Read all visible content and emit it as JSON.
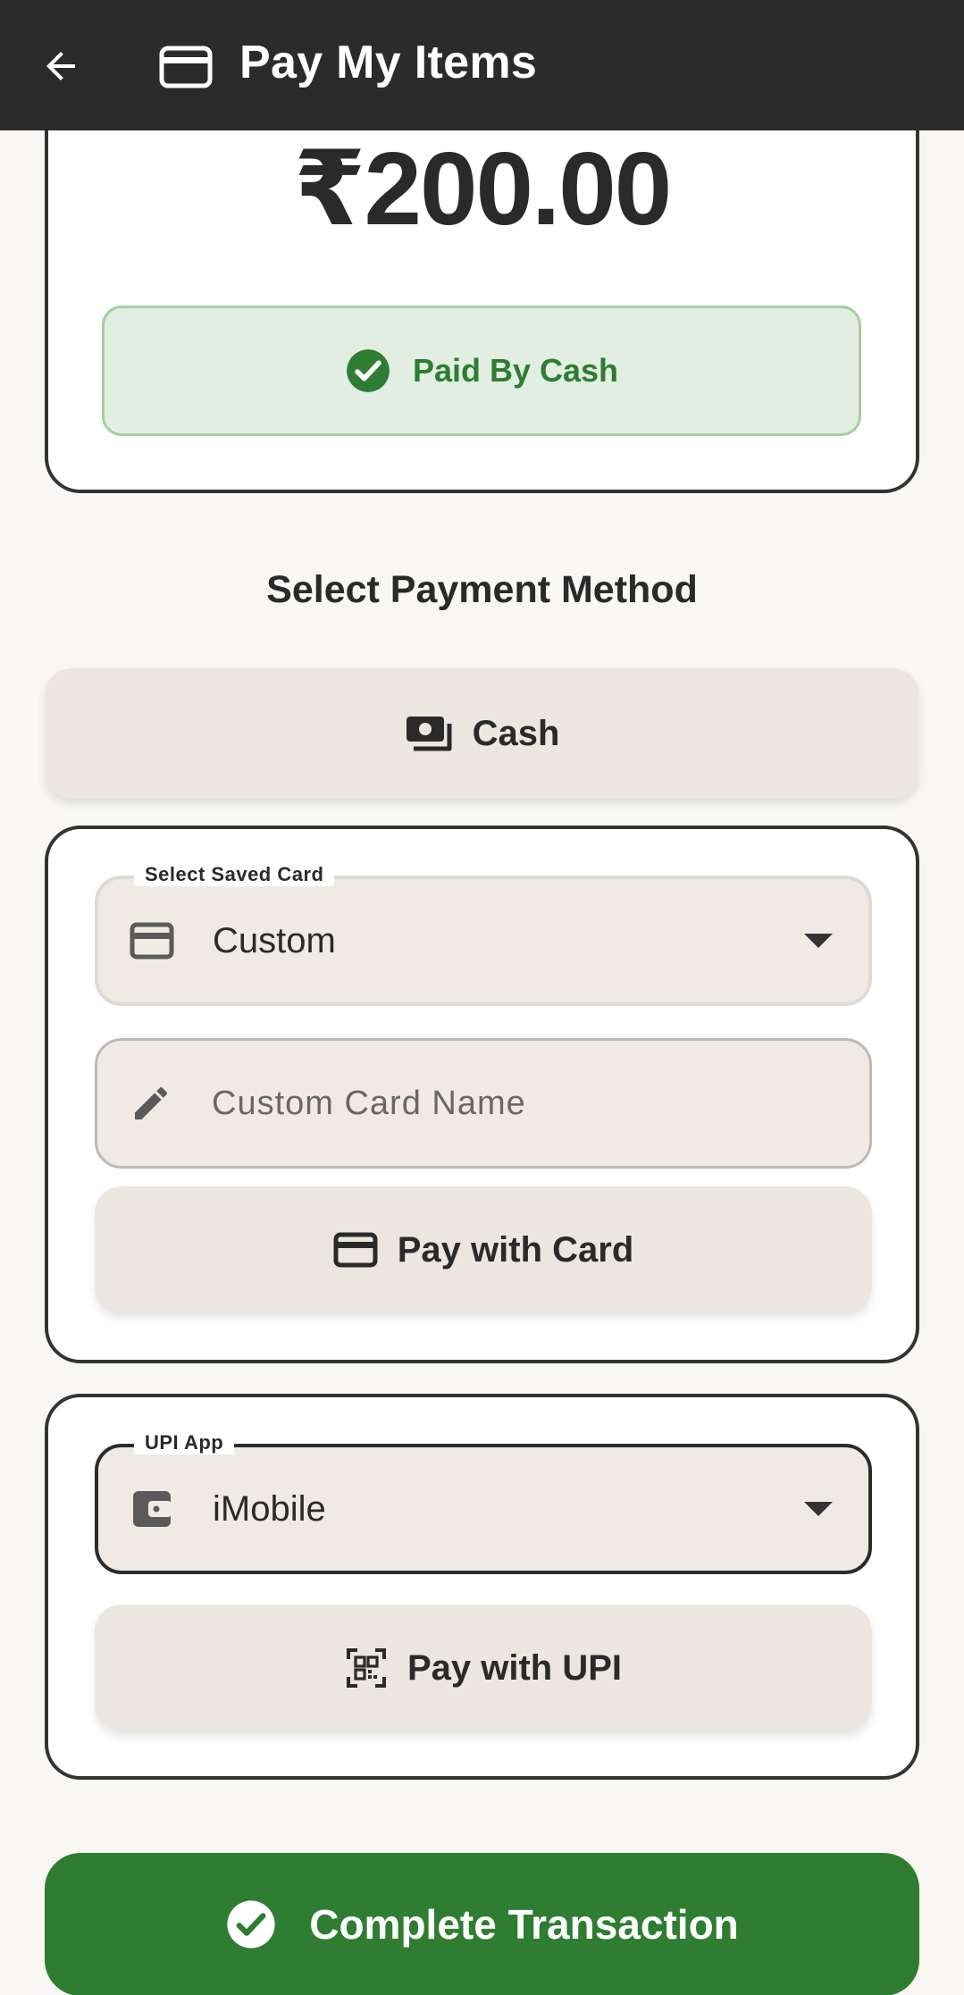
{
  "appbar": {
    "title": "Pay My Items",
    "back_icon": "arrow-left-icon",
    "title_icon": "credit-card-icon"
  },
  "summary": {
    "amount": "₹200.00",
    "status_label": "Paid By Cash",
    "status_icon": "check-circle-icon"
  },
  "payment": {
    "heading": "Select Payment Method",
    "cash_button_label": "Cash",
    "card": {
      "saved_card_label": "Select Saved Card",
      "saved_card_value": "Custom",
      "custom_name_placeholder": "Custom Card Name",
      "custom_name_value": "",
      "pay_button_label": "Pay with Card"
    },
    "upi": {
      "app_label": "UPI App",
      "app_value": "iMobile",
      "pay_button_label": "Pay with UPI"
    }
  },
  "footer": {
    "complete_label": "Complete Transaction"
  },
  "colors": {
    "appbar": "#2b2b2b",
    "success": "#2e7d32",
    "success_bg": "#e2eee2",
    "button_bg": "#ebe7e0",
    "page_bg": "#f8f7f3"
  }
}
